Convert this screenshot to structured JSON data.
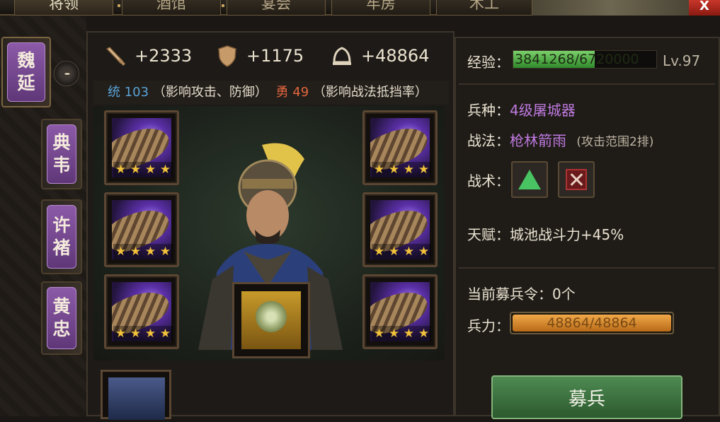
{
  "top_tabs": [
    {
      "label": "将领",
      "active": true
    },
    {
      "label": "酒馆",
      "active": false
    },
    {
      "label": "宴会",
      "active": false
    },
    {
      "label": "牢房",
      "active": false
    },
    {
      "label": "木工",
      "active": false
    }
  ],
  "close_label": "X",
  "generals": [
    {
      "name_1": "魏",
      "name_2": "延",
      "active": true
    },
    {
      "name_1": "典",
      "name_2": "韦",
      "active": false
    },
    {
      "name_1": "许",
      "name_2": "褚",
      "active": false
    },
    {
      "name_1": "黄",
      "name_2": "忠",
      "active": false
    }
  ],
  "stats": {
    "attack": "+2333",
    "defense": "+1175",
    "troops": "+48864"
  },
  "attributes": {
    "tong_label": "统",
    "tong_value": "103",
    "tong_desc": "（影响攻击、防御）",
    "yong_label": "勇",
    "yong_value": "49",
    "yong_desc": "（影响战法抵挡率）"
  },
  "equipment": {
    "star_glyph": "★",
    "slots": [
      {
        "stars": 4
      },
      {
        "stars": 4
      },
      {
        "stars": 4
      },
      {
        "stars": 4
      },
      {
        "stars": 4
      },
      {
        "stars": 4
      }
    ]
  },
  "info": {
    "exp_label": "经验：",
    "exp_text": "3841268/6720000",
    "exp_fraction": 0.5716,
    "level": "Lv.97",
    "unit_label": "兵种：",
    "unit_value": "4级屠城器",
    "tactic_label": "战法：",
    "tactic_value": "枪林箭雨",
    "tactic_note": "(攻击范围2排)",
    "skills_label": "战术：",
    "talent_label": "天赋：",
    "talent_value": "城池战斗力+45%",
    "recruit_orders": "当前募兵令：0个",
    "troop_label": "兵力：",
    "troop_text": "48864/48864",
    "troop_fraction": 1.0,
    "recruit_button": "募兵"
  },
  "colors": {
    "accent_purple": "#c07ae0",
    "tong_blue": "#5aa2d6",
    "yong_red": "#e2663d",
    "exp_green": "#4fb043",
    "troop_orange": "#e59a3a"
  }
}
